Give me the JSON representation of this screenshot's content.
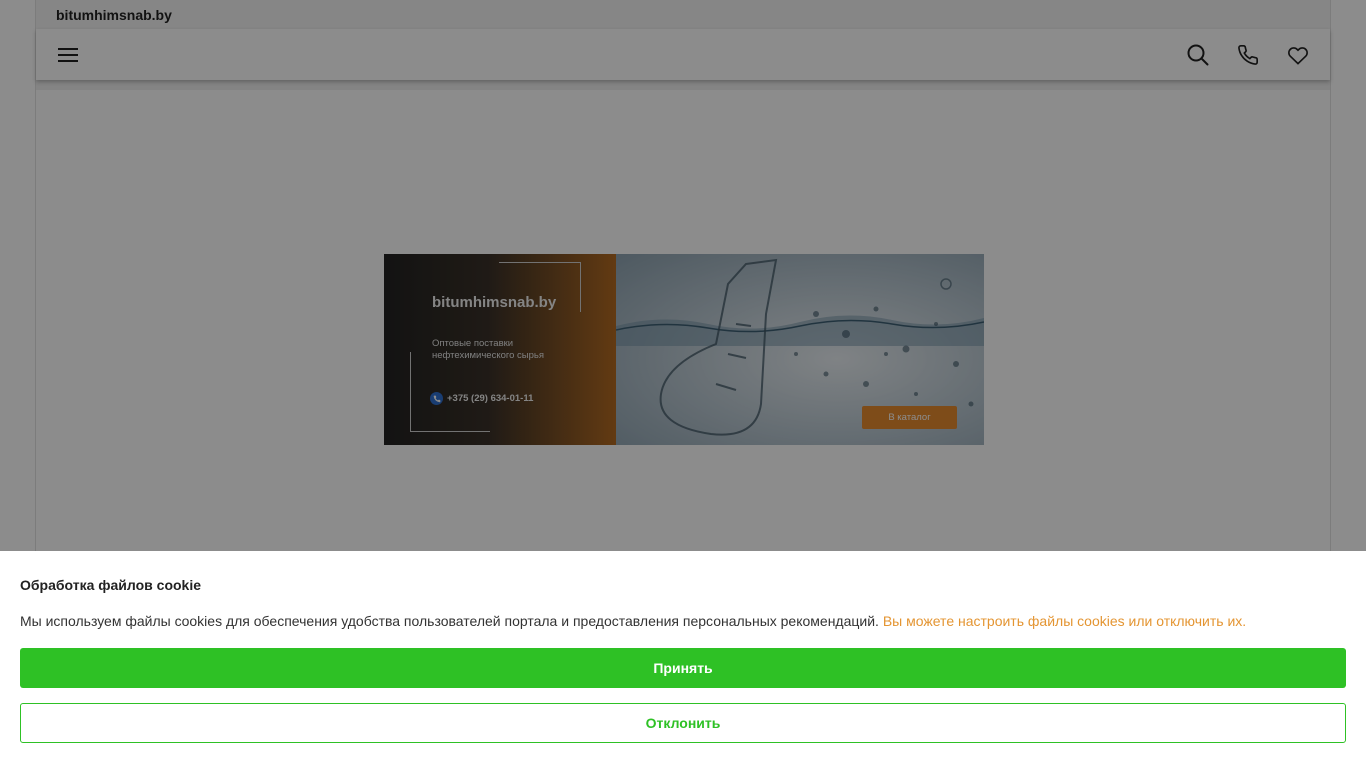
{
  "site": {
    "domain": "bitumhimsnab.by"
  },
  "nav": {
    "menu_icon": "hamburger-menu-icon",
    "search_icon": "search-icon",
    "phone_icon": "phone-icon",
    "favorites_icon": "heart-icon"
  },
  "banner": {
    "domain": "bitumhimsnab.by",
    "description": "Оптовые поставки нефтехимического сырья",
    "phone": "+375 (29) 634-01-11",
    "cta_label": "В каталог"
  },
  "cookie": {
    "title": "Обработка файлов cookie",
    "text": "Мы используем файлы cookies для обеспечения удобства пользователей портала и предоставления персональных рекомендаций.",
    "link_text": "Вы можете настроить файлы cookies или отключить их.",
    "accept_label": "Принять",
    "decline_label": "Отклонить"
  },
  "colors": {
    "accent_green": "#2ec125",
    "link_orange": "#e49532",
    "cta_orange": "#e58a2f"
  }
}
